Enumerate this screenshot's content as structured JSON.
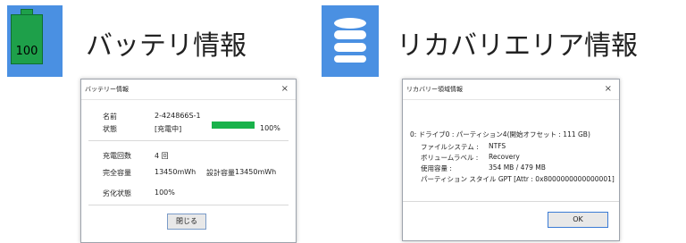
{
  "header": {
    "left": {
      "title": "バッテリ情報",
      "icon": "battery-icon",
      "battery_text": "100",
      "tile_color": "#4a90e2",
      "battery_color": "#1ea04a"
    },
    "right": {
      "title": "リカバリエリア情報",
      "icon": "database-icon",
      "tile_color": "#4a90e2"
    }
  },
  "battery_window": {
    "title": "バッテリー情報",
    "close_icon": "×",
    "name_label": "名前",
    "name_value": "2-424866S-1",
    "status_label": "状態",
    "status_value": "[充電中]",
    "charge_percent_text": "100%",
    "charge_fraction": 1.0,
    "charge_count_label": "充電回数",
    "charge_count_value": "4 回",
    "capacity_label": "完全容量",
    "capacity_value": "13450mWh",
    "design_capacity_label": "設計容量",
    "design_capacity_value": "13450mWh",
    "health_label": "劣化状態",
    "health_value": "100%",
    "close_button": "閉じる"
  },
  "recovery_window": {
    "title": "リカバリー領域情報",
    "close_icon": "×",
    "drive_line": "0:  ドライブ0 : パーティション4(開始オフセット : 111 GB)",
    "fs_label": "ファイルシステム :",
    "fs_value": "NTFS",
    "volume_label": "ボリュームラベル :",
    "volume_value": "Recovery",
    "usage_label": "使用容量 :",
    "usage_value": "354 MB / 479 MB",
    "partition_line": "パーティション スタイル GPT [Attr : 0x8000000000000001]",
    "ok_button": "OK"
  }
}
